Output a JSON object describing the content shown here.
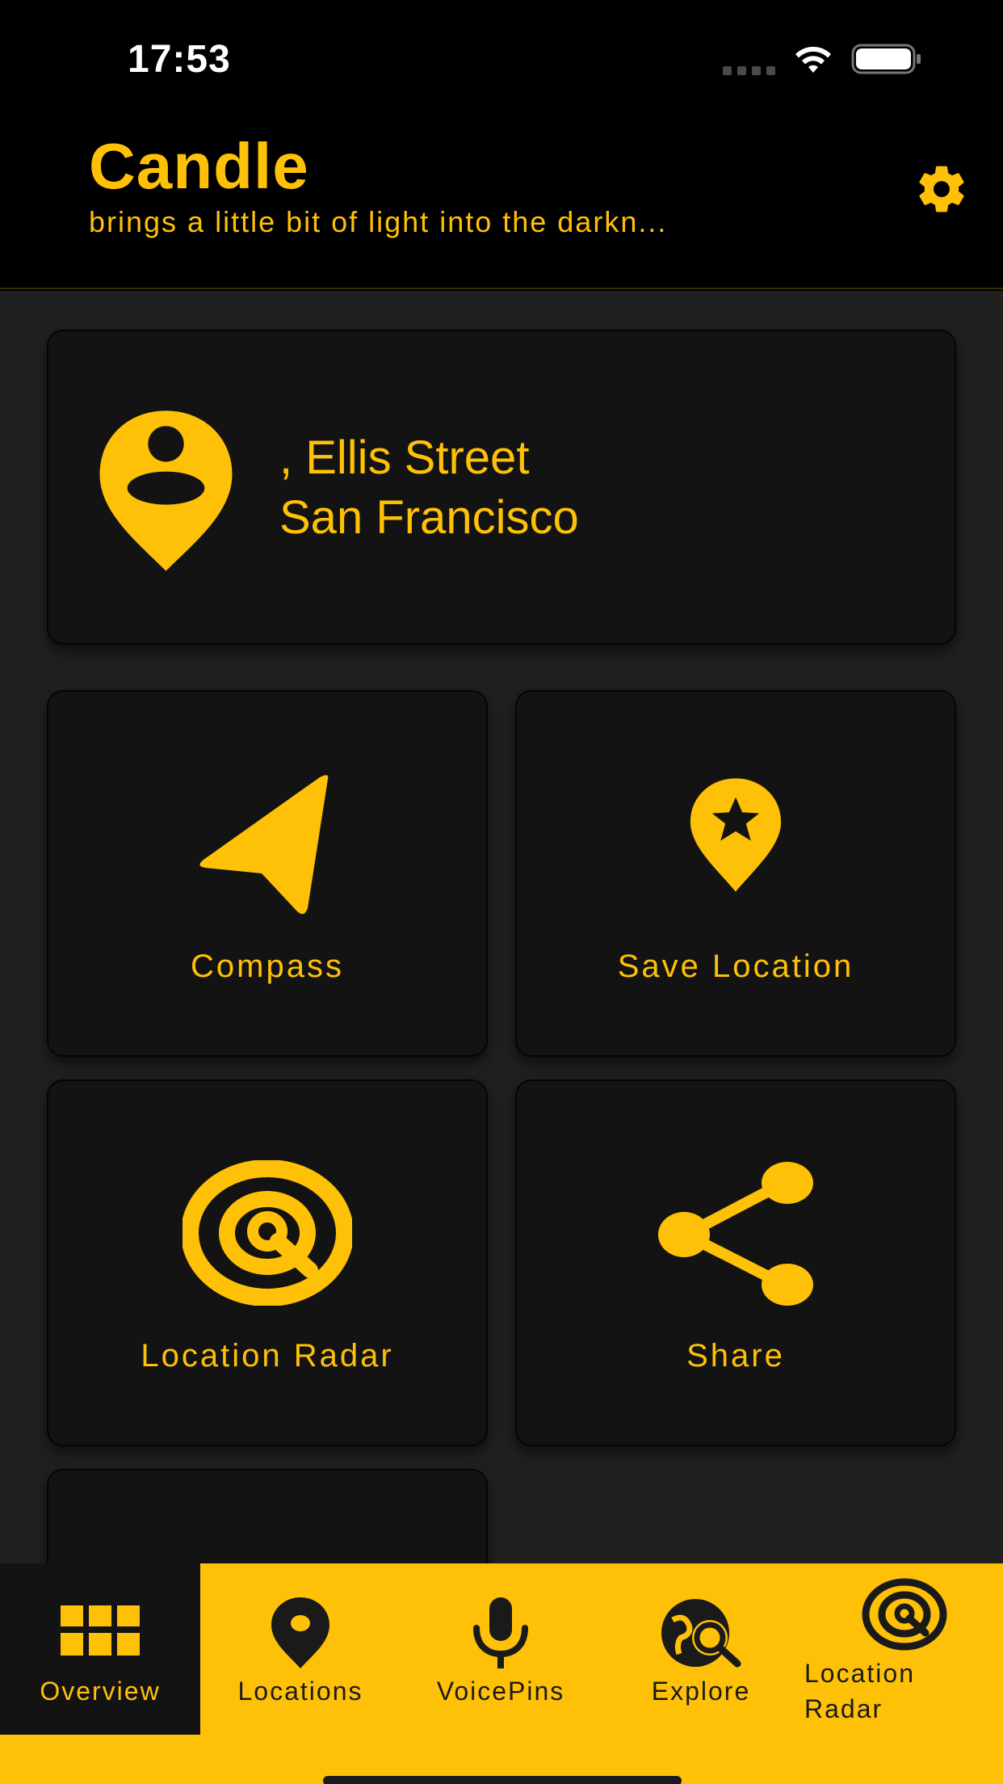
{
  "status_bar": {
    "time": "17:53"
  },
  "header": {
    "title": "Candle",
    "subtitle": "brings a little bit of light into the darkn..."
  },
  "location_card": {
    "line1": ", Ellis Street",
    "line2": "San Francisco",
    "icon": "person-pin-icon"
  },
  "tiles": [
    {
      "label": "Compass",
      "icon": "navigation-arrow-icon"
    },
    {
      "label": "Save Location",
      "icon": "star-pin-icon"
    },
    {
      "label": "Location Radar",
      "icon": "radar-icon"
    },
    {
      "label": "Share",
      "icon": "share-icon"
    }
  ],
  "tabs": [
    {
      "label": "Overview",
      "icon": "grid-icon",
      "active": true
    },
    {
      "label": "Locations",
      "icon": "location-pin-icon"
    },
    {
      "label": "VoicePins",
      "icon": "microphone-icon"
    },
    {
      "label": "Explore",
      "icon": "explore-globe-icon"
    },
    {
      "label": "Location Radar",
      "label_line1": "Location",
      "label_line2": "Radar",
      "icon": "radar-icon"
    }
  ],
  "colors": {
    "accent": "#FFC107",
    "background": "#202020",
    "card": "#131313",
    "header": "#000000"
  }
}
